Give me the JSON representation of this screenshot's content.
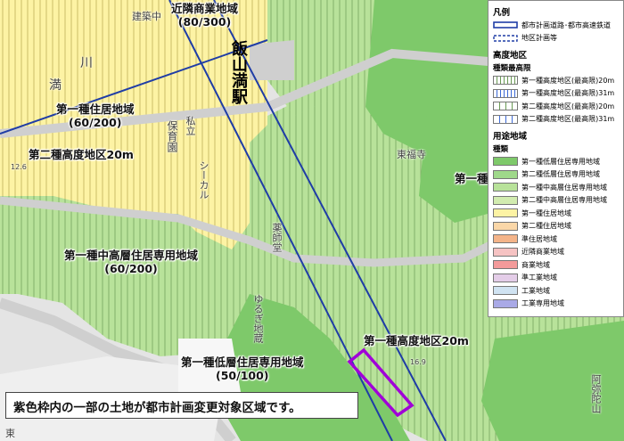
{
  "map": {
    "zones": [
      {
        "label": "近隣商業地域",
        "ratio": "(80/300)"
      },
      {
        "label": "第一種住居地域",
        "ratio": "(60/200)"
      },
      {
        "label": "第二種高度地区20m"
      },
      {
        "label": "第一種中高層住居専用地域",
        "ratio": "(60/200)"
      },
      {
        "label": "第一種高度地区20m"
      },
      {
        "label": "第一種低層住居専用地域",
        "ratio": "(50/100)"
      },
      {
        "label": "第一種"
      }
    ],
    "station": "飯山満駅",
    "places": [
      "建築中",
      "満",
      "川",
      "保育園",
      "私立",
      "シーカル",
      "東福寺",
      "薬師堂",
      "ゆるぎ地蔵",
      "東",
      "阿弥陀山",
      "12.6",
      "16.9"
    ]
  },
  "legend": {
    "title": "凡例",
    "line_items": [
      "都市計画道路･都市高速鉄道",
      "地区計画等"
    ],
    "height_title": "高度地区",
    "height_sub": "種類最高限",
    "height_items": [
      "第一種高度地区(最高限)20m",
      "第一種高度地区(最高限)31m",
      "第二種高度地区(最高限)20m",
      "第二種高度地区(最高限)31m"
    ],
    "use_title": "用途地域",
    "use_sub": "種類",
    "use_items": [
      {
        "label": "第一種低層住居専用地域",
        "color": "#7ec96a"
      },
      {
        "label": "第二種低層住居専用地域",
        "color": "#9fd98a"
      },
      {
        "label": "第一種中高層住居専用地域",
        "color": "#b8e29a"
      },
      {
        "label": "第二種中高層住居専用地域",
        "color": "#d2ecb0"
      },
      {
        "label": "第一種住居地域",
        "color": "#fdf3a4"
      },
      {
        "label": "第二種住居地域",
        "color": "#fad7a8"
      },
      {
        "label": "準住居地域",
        "color": "#f4b489"
      },
      {
        "label": "近隣商業地域",
        "color": "#f6c3c3"
      },
      {
        "label": "商業地域",
        "color": "#f39a9a"
      },
      {
        "label": "準工業地域",
        "color": "#e4cde8"
      },
      {
        "label": "工業地域",
        "color": "#d0e3f2"
      },
      {
        "label": "工業専用地域",
        "color": "#a9a9e6"
      }
    ]
  },
  "note": "紫色枠内の一部の土地が都市計画変更対象区域です。",
  "colors": {
    "rail": "#1f3da6",
    "target": "#a000d8",
    "green_dark": "#7ec96a",
    "green_mid": "#b8e29a",
    "yellow": "#fdf3a4"
  }
}
